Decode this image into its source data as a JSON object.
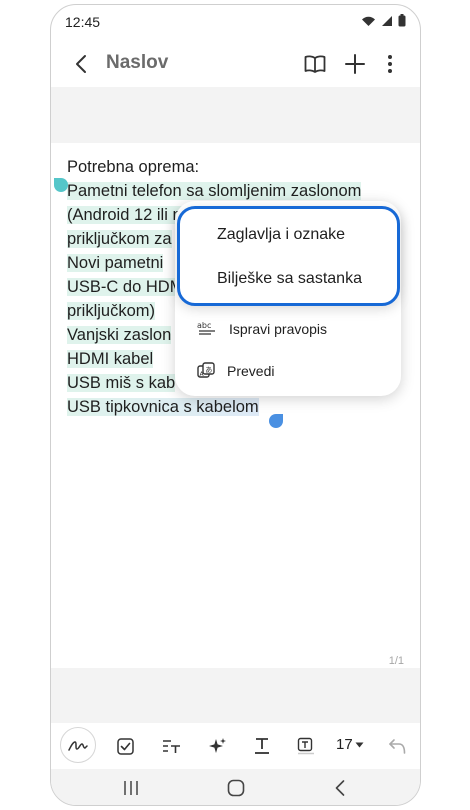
{
  "status_bar": {
    "time": "12:45",
    "icons": [
      "wifi-icon",
      "signal-icon",
      "battery-icon"
    ]
  },
  "app_bar": {
    "title": "Naslov",
    "icons": [
      "back-icon",
      "book-icon",
      "plus-icon",
      "more-vert-icon"
    ]
  },
  "note": {
    "lines": [
      {
        "text": "Potrebna oprema:",
        "highlighted": false
      },
      {
        "text": "Pametni telefon sa slomljenim zaslonom",
        "highlighted": true
      },
      {
        "text": "(Android 12 ili n",
        "highlighted": true
      },
      {
        "text": "priključkom za",
        "highlighted": true
      },
      {
        "text": "Novi pametni",
        "highlighted": true
      },
      {
        "text": "USB-C do HDM",
        "highlighted": true
      },
      {
        "text": "priključkom)",
        "highlighted": true
      },
      {
        "text": "Vanjski zaslon",
        "highlighted": true
      },
      {
        "text": "HDMI kabel",
        "highlighted": true
      },
      {
        "text": "USB miš s kab",
        "highlighted": true
      },
      {
        "text": "USB tipkovnica s kabelom",
        "highlighted": true
      }
    ],
    "page_indicator": "1/1"
  },
  "context_menu": {
    "items": [
      {
        "label": "Ispravi pravopis",
        "icon": "spellcheck-icon"
      },
      {
        "label": "Prevedi",
        "icon": "translate-icon"
      }
    ]
  },
  "submenu": {
    "items": [
      {
        "label": "Zaglavlja i oznake"
      },
      {
        "label": "Bilješke sa sastanka"
      }
    ],
    "accent_color": "#1769d6"
  },
  "toolbar": {
    "icons": [
      "pen-icon",
      "checkbox-icon",
      "paragraph-style-icon",
      "ai-sparkle-icon",
      "text-underline-icon",
      "text-box-icon",
      "undo-icon"
    ],
    "font_size": "17"
  },
  "nav_bar": {
    "icons": [
      "recents-icon",
      "home-icon",
      "back-nav-icon"
    ]
  },
  "colors": {
    "selection_highlight": "#dff3ec",
    "start_handle": "#55c6c9",
    "end_handle": "#4a90e2"
  }
}
